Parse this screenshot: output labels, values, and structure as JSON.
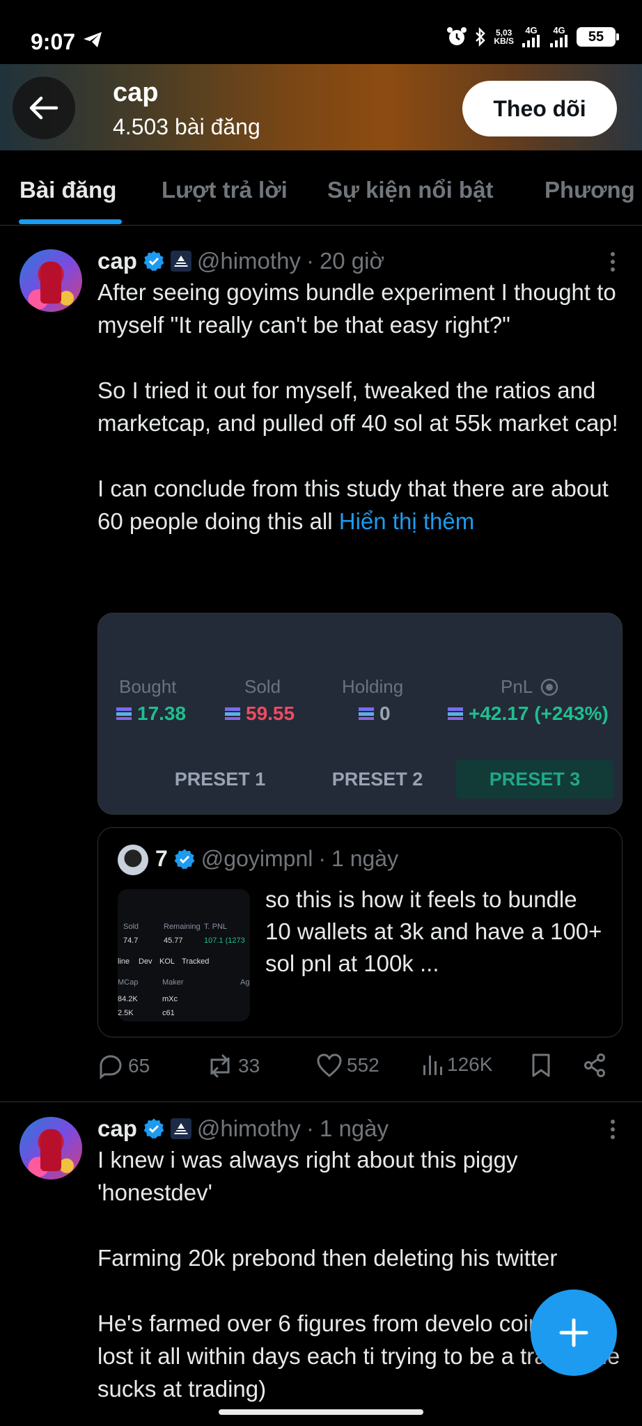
{
  "status_bar": {
    "time": "9:07",
    "speed_value": "5,03",
    "speed_unit": "KB/S",
    "net1": "4G",
    "net2": "4G",
    "battery": "55"
  },
  "header": {
    "name": "cap",
    "post_count": "4.503 bài đăng",
    "follow_label": "Theo dõi"
  },
  "tabs": [
    {
      "label": "Bài đăng"
    },
    {
      "label": "Lượt trả lời"
    },
    {
      "label": "Sự kiện nổi bật"
    },
    {
      "label": "Phương"
    }
  ],
  "posts": [
    {
      "name": "cap",
      "handle": "@himothy",
      "dot": "·",
      "time": "20 giờ",
      "paragraphs": [
        "After seeing goyims bundle experiment I thought to myself \"It really can't be that easy right?\"",
        "So I tried it out for myself, tweaked the ratios and marketcap, and pulled off 40 sol at 55k market cap!",
        "I can conclude from this study that there are about 60 people doing this all "
      ],
      "show_more": "Hiển thị thêm",
      "media": {
        "cols": [
          {
            "label": "Bought",
            "value": "17.38",
            "color": "#1fbf8f"
          },
          {
            "label": "Sold",
            "value": "59.55",
            "color": "#ef4b62"
          },
          {
            "label": "Holding",
            "value": "0",
            "color": "#9aa3b3"
          },
          {
            "label": "PnL",
            "value": "+42.17 (+243%)",
            "color": "#1fbf8f"
          }
        ],
        "presets": [
          "PRESET 1",
          "PRESET 2",
          "PRESET 3"
        ],
        "active_preset": "PRESET 3"
      },
      "quote": {
        "name": "7",
        "handle": "@goyimpnl",
        "dot": "·",
        "time": "1 ngày",
        "text": "so this is how it feels to bundle 10 wallets at 3k and have a 100+ sol pnl at 100k ...",
        "thumb": {
          "sold": "Sold",
          "remaining": "Remaining",
          "tpnl": "T. PNL",
          "v1": "74.7",
          "v2": "45.77",
          "v3": "107.1 (1273",
          "tab1": "line",
          "tab2": "Dev",
          "tab3": "KOL",
          "tab4": "Tracked",
          "mcap": "MCap",
          "maker": "Maker",
          "age": "Ag",
          "r1a": "84.2K",
          "r1b": "mXc",
          "r2a": "2.5K",
          "r2b": "c61"
        }
      },
      "actions": {
        "replies": "65",
        "reposts": "33",
        "likes": "552",
        "views": "126K"
      }
    },
    {
      "name": "cap",
      "handle": "@himothy",
      "dot": "·",
      "time": "1 ngày",
      "paragraphs": [
        "I knew i was always right about this piggy 'honestdev'",
        "Farming 20k prebond then deleting his twitter",
        "He's farmed over 6 figures from develo coins, then lost it all within days each ti trying to be a trader (he sucks at trading)"
      ]
    }
  ],
  "colors": {
    "accent": "#1d9bf0",
    "background": "#000000",
    "text": "#e7e9ea",
    "muted": "#71767b"
  },
  "icons": {
    "back": "arrow-left-icon",
    "verified": "verified-badge-icon",
    "fab": "plus-icon"
  }
}
